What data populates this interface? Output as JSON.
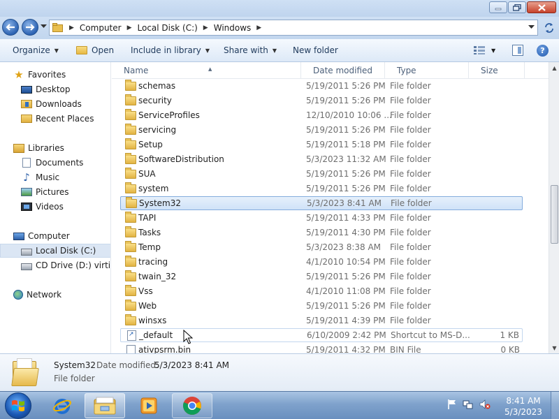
{
  "address": {
    "crumbs": [
      "Computer",
      "Local Disk (C:)",
      "Windows"
    ]
  },
  "toolbar": {
    "organize": "Organize",
    "open": "Open",
    "include_in_library": "Include in library",
    "share_with": "Share with",
    "new_folder": "New folder"
  },
  "nav": {
    "favorites": "Favorites",
    "desktop": "Desktop",
    "downloads": "Downloads",
    "recent_places": "Recent Places",
    "libraries": "Libraries",
    "documents": "Documents",
    "music": "Music",
    "pictures": "Pictures",
    "videos": "Videos",
    "computer": "Computer",
    "local_disk": "Local Disk (C:)",
    "cd_drive": "CD Drive (D:) virtio-win",
    "network": "Network"
  },
  "columns": {
    "name": "Name",
    "date": "Date modified",
    "type": "Type",
    "size": "Size"
  },
  "files": [
    {
      "name": "schemas",
      "date": "5/19/2011 5:26 PM",
      "type": "File folder",
      "size": "",
      "icon": "folder"
    },
    {
      "name": "security",
      "date": "5/19/2011 5:26 PM",
      "type": "File folder",
      "size": "",
      "icon": "folder"
    },
    {
      "name": "ServiceProfiles",
      "date": "12/10/2010 10:06 ...",
      "type": "File folder",
      "size": "",
      "icon": "folder"
    },
    {
      "name": "servicing",
      "date": "5/19/2011 5:26 PM",
      "type": "File folder",
      "size": "",
      "icon": "folder"
    },
    {
      "name": "Setup",
      "date": "5/19/2011 5:18 PM",
      "type": "File folder",
      "size": "",
      "icon": "folder"
    },
    {
      "name": "SoftwareDistribution",
      "date": "5/3/2023 11:32 AM",
      "type": "File folder",
      "size": "",
      "icon": "folder"
    },
    {
      "name": "SUA",
      "date": "5/19/2011 5:26 PM",
      "type": "File folder",
      "size": "",
      "icon": "folder"
    },
    {
      "name": "system",
      "date": "5/19/2011 5:26 PM",
      "type": "File folder",
      "size": "",
      "icon": "folder"
    },
    {
      "name": "System32",
      "date": "5/3/2023 8:41 AM",
      "type": "File folder",
      "size": "",
      "icon": "folder"
    },
    {
      "name": "TAPI",
      "date": "5/19/2011 4:33 PM",
      "type": "File folder",
      "size": "",
      "icon": "folder"
    },
    {
      "name": "Tasks",
      "date": "5/19/2011 4:30 PM",
      "type": "File folder",
      "size": "",
      "icon": "folder"
    },
    {
      "name": "Temp",
      "date": "5/3/2023 8:38 AM",
      "type": "File folder",
      "size": "",
      "icon": "folder"
    },
    {
      "name": "tracing",
      "date": "4/1/2010 10:54 PM",
      "type": "File folder",
      "size": "",
      "icon": "folder"
    },
    {
      "name": "twain_32",
      "date": "5/19/2011 5:26 PM",
      "type": "File folder",
      "size": "",
      "icon": "folder"
    },
    {
      "name": "Vss",
      "date": "4/1/2010 11:08 PM",
      "type": "File folder",
      "size": "",
      "icon": "folder"
    },
    {
      "name": "Web",
      "date": "5/19/2011 5:26 PM",
      "type": "File folder",
      "size": "",
      "icon": "folder"
    },
    {
      "name": "winsxs",
      "date": "5/19/2011 4:39 PM",
      "type": "File folder",
      "size": "",
      "icon": "folder"
    },
    {
      "name": "_default",
      "date": "6/10/2009 2:42 PM",
      "type": "Shortcut to MS-D...",
      "size": "1 KB",
      "icon": "shortcut"
    },
    {
      "name": "ativpsrm.bin",
      "date": "5/19/2011 4:32 PM",
      "type": "BIN File",
      "size": "0 KB",
      "icon": "bin"
    }
  ],
  "selected_index": 8,
  "hover_index": 17,
  "details": {
    "name": "System32",
    "date_label": "Date modified:",
    "date_value": "5/3/2023 8:41 AM",
    "type": "File folder"
  },
  "taskbar": {
    "time": "8:41 AM",
    "date": "5/3/2023"
  },
  "colors": {
    "selection": "#cfe2f8",
    "selection_border": "#84acdd",
    "accent": "#1e395b",
    "taskbar": "#7fa2cc"
  }
}
